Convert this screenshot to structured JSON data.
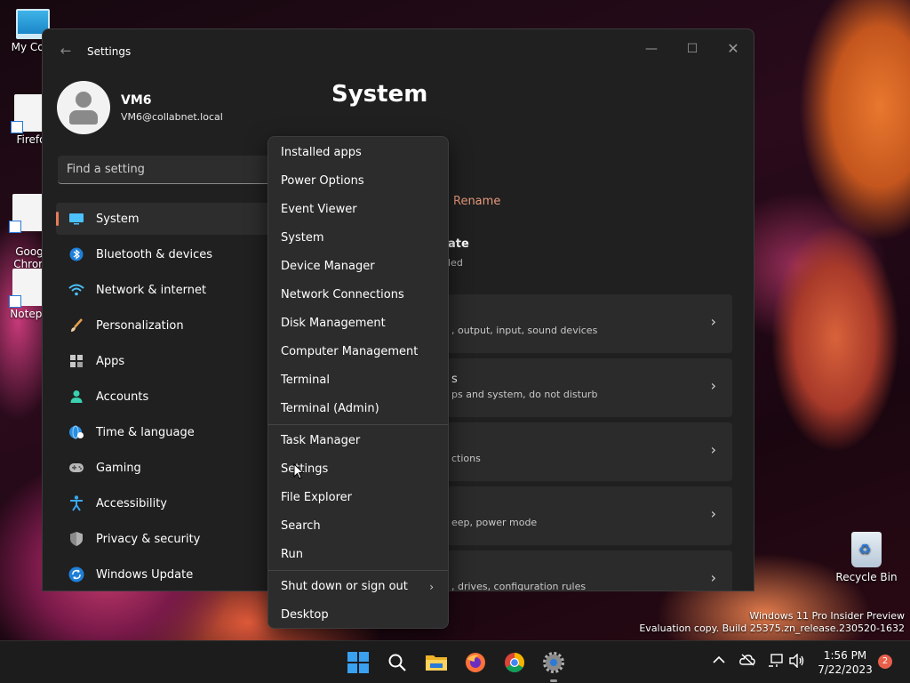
{
  "desktop": {
    "icons": [
      {
        "label": "My Com"
      },
      {
        "label": "Firefo"
      },
      {
        "label": "Goog\nChron"
      },
      {
        "label": "Notepa"
      }
    ],
    "recycle_bin": "Recycle Bin",
    "watermark": {
      "line1": "Windows 11 Pro Insider Preview",
      "line2": "Evaluation copy. Build 25375.zn_release.230520-1632"
    }
  },
  "window": {
    "title": "Settings",
    "back_glyph": "←",
    "controls": {
      "minimize": "—",
      "maximize": "☐",
      "close": "✕"
    }
  },
  "profile": {
    "name": "VM6",
    "email": "VM6@collabnet.local"
  },
  "search": {
    "placeholder": "Find a setting"
  },
  "nav": {
    "items": [
      {
        "label": "System",
        "icon": "monitor-icon",
        "active": true
      },
      {
        "label": "Bluetooth & devices",
        "icon": "bluetooth-icon"
      },
      {
        "label": "Network & internet",
        "icon": "wifi-icon"
      },
      {
        "label": "Personalization",
        "icon": "brush-icon"
      },
      {
        "label": "Apps",
        "icon": "apps-icon"
      },
      {
        "label": "Accounts",
        "icon": "person-icon"
      },
      {
        "label": "Time & language",
        "icon": "globe-clock-icon"
      },
      {
        "label": "Gaming",
        "icon": "gamepad-icon"
      },
      {
        "label": "Accessibility",
        "icon": "accessibility-icon"
      },
      {
        "label": "Privacy & security",
        "icon": "shield-icon"
      },
      {
        "label": "Windows Update",
        "icon": "update-icon"
      }
    ]
  },
  "main": {
    "title": "System",
    "rename": "Rename",
    "update_title": "ate",
    "update_sub": "led",
    "cards": [
      {
        "title": "",
        "desc": ", output, input, sound devices"
      },
      {
        "title": "s",
        "desc": "ps and system, do not disturb"
      },
      {
        "title": "",
        "desc": "ctions"
      },
      {
        "title": "",
        "desc": "eep, power mode"
      },
      {
        "title": "",
        "desc": ", drives, configuration rules"
      }
    ]
  },
  "context_menu": {
    "group1": [
      "Installed apps",
      "Power Options",
      "Event Viewer",
      "System",
      "Device Manager",
      "Network Connections",
      "Disk Management",
      "Computer Management",
      "Terminal",
      "Terminal (Admin)"
    ],
    "group2": [
      "Task Manager",
      "Settings",
      "File Explorer",
      "Search",
      "Run"
    ],
    "group3": [
      "Shut down or sign out",
      "Desktop"
    ],
    "submenu_glyph": "›"
  },
  "taskbar": {
    "clock_time": "1:56 PM",
    "clock_date": "7/22/2023",
    "notification_count": "2"
  },
  "colors": {
    "accent": "#e67c5a",
    "window_bg": "#202020",
    "menu_bg": "#2c2c2c",
    "card_bg": "#2b2b2b"
  }
}
